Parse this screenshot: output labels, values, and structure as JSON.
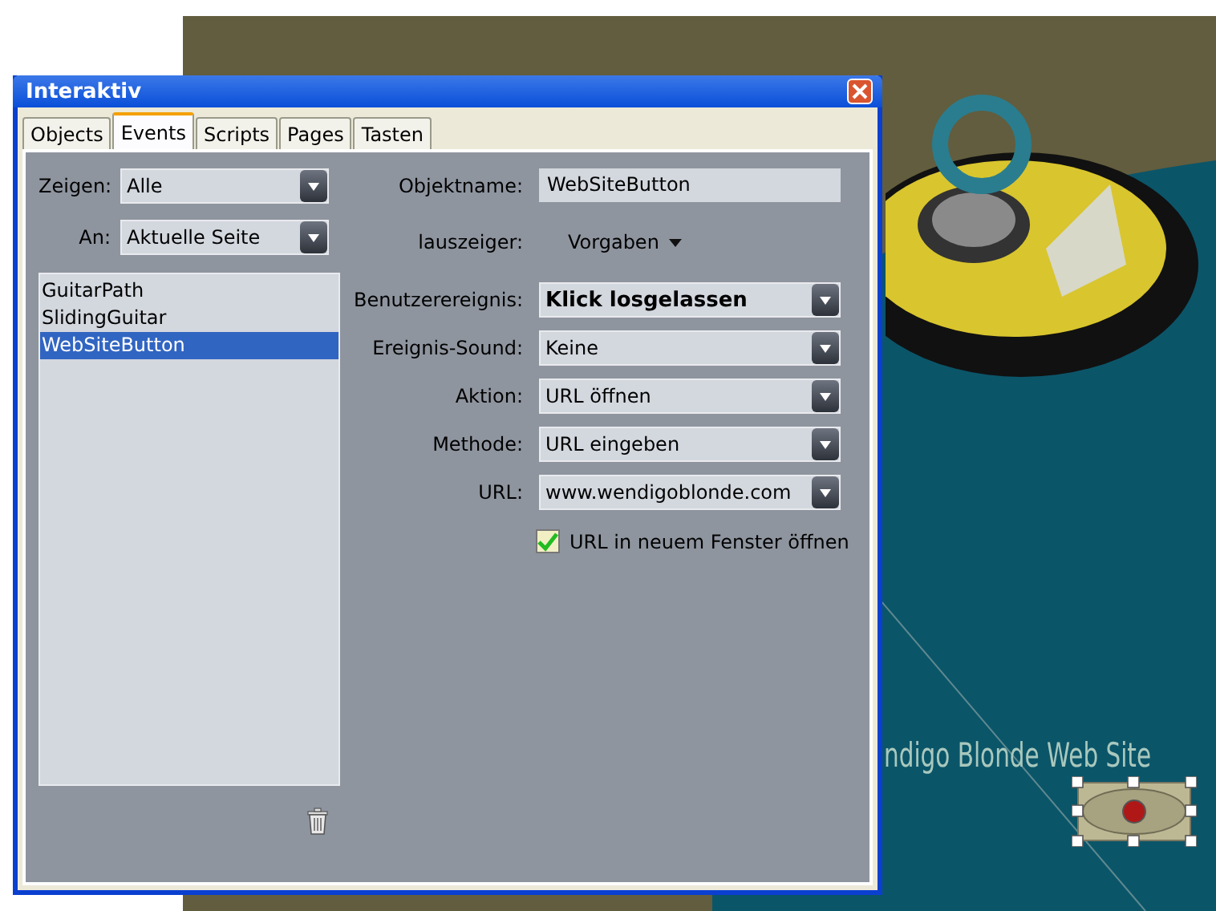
{
  "window": {
    "title": "Interaktiv"
  },
  "tabs": [
    {
      "label": "Objects",
      "selected": false
    },
    {
      "label": "Events",
      "selected": true
    },
    {
      "label": "Scripts",
      "selected": false
    },
    {
      "label": "Pages",
      "selected": false
    },
    {
      "label": "Tasten",
      "selected": false
    }
  ],
  "filters": [
    {
      "label": "Zeigen:",
      "value": "Alle"
    },
    {
      "label": "An:",
      "value": "Aktuelle Seite"
    }
  ],
  "objects": [
    {
      "name": "GuitarPath",
      "selected": false
    },
    {
      "name": "SlidingGuitar",
      "selected": false
    },
    {
      "name": "WebSiteButton",
      "selected": true
    }
  ],
  "fields": [
    {
      "kind": "text",
      "label": "Objektname:",
      "value": "WebSiteButton"
    },
    {
      "kind": "menu",
      "label": "lauszeiger:",
      "value": "Vorgaben"
    },
    {
      "kind": "dropdown",
      "label": "Benutzerereignis:",
      "value": "Klick losgelassen",
      "bold": true
    },
    {
      "kind": "dropdown",
      "label": "Ereignis-Sound:",
      "value": "Keine",
      "bold": false
    },
    {
      "kind": "dropdown",
      "label": "Aktion:",
      "value": "URL öffnen",
      "bold": false
    },
    {
      "kind": "dropdown",
      "label": "Methode:",
      "value": "URL eingeben",
      "bold": false
    },
    {
      "kind": "dropdown",
      "label": "URL:",
      "value": "www.wendigoblonde.com",
      "bold": false
    }
  ],
  "new_window": {
    "label": "URL in neuem Fenster öffnen",
    "checked": true
  },
  "canvas": {
    "caption": "ndigo Blonde Web Site"
  }
}
